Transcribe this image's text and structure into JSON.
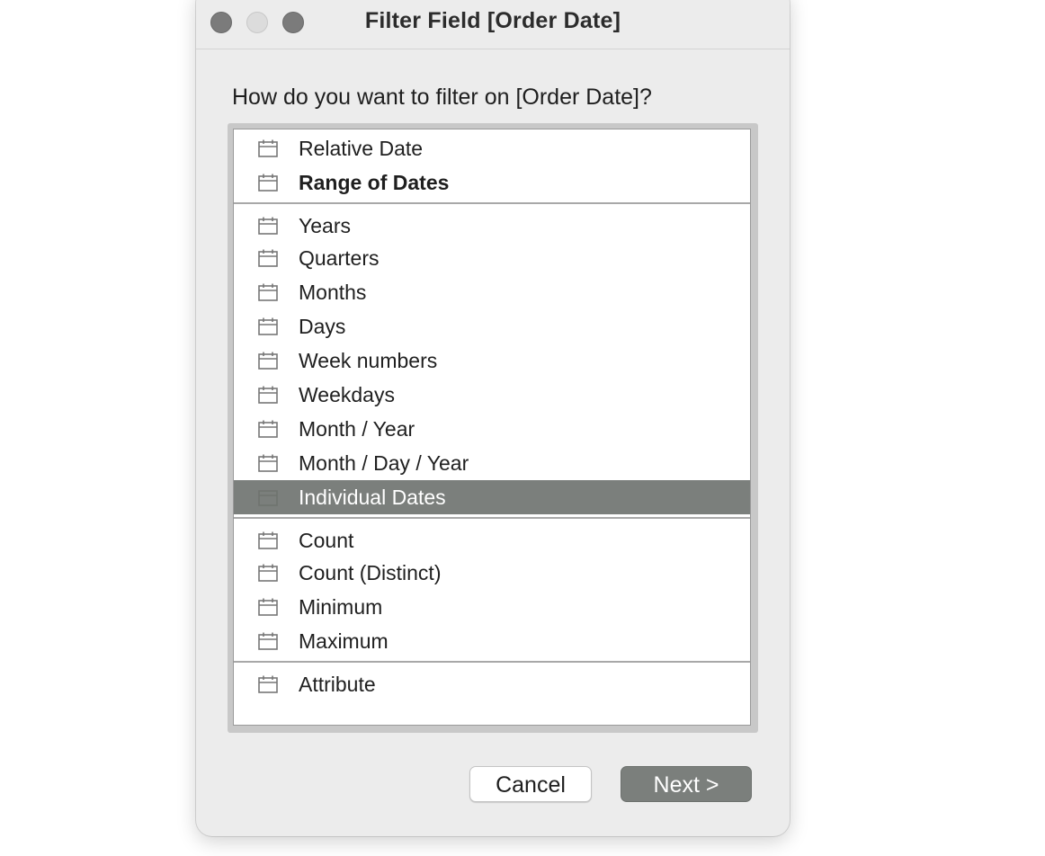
{
  "window": {
    "title": "Filter Field [Order Date]"
  },
  "dialog": {
    "prompt": "How do you want to filter on [Order Date]?"
  },
  "filter_options": {
    "group_date_range": [
      {
        "label": "Relative Date",
        "icon": "calendar-icon",
        "bold": false
      },
      {
        "label": "Range of Dates",
        "icon": "calendar-icon",
        "bold": true
      }
    ],
    "group_date_parts": [
      {
        "label": "Years",
        "icon": "calendar-icon"
      },
      {
        "label": "Quarters",
        "icon": "calendar-icon"
      },
      {
        "label": "Months",
        "icon": "calendar-icon"
      },
      {
        "label": "Days",
        "icon": "calendar-icon"
      },
      {
        "label": "Week numbers",
        "icon": "calendar-icon"
      },
      {
        "label": "Weekdays",
        "icon": "calendar-icon"
      },
      {
        "label": "Month / Year",
        "icon": "calendar-icon"
      },
      {
        "label": "Month / Day / Year",
        "icon": "calendar-icon"
      },
      {
        "label": "Individual Dates",
        "icon": "calendar-icon",
        "selected": true
      }
    ],
    "group_measures": [
      {
        "label": "Count",
        "icon": "calendar-icon"
      },
      {
        "label": "Count (Distinct)",
        "icon": "calendar-icon"
      },
      {
        "label": "Minimum",
        "icon": "calendar-icon"
      },
      {
        "label": "Maximum",
        "icon": "calendar-icon"
      }
    ],
    "group_attribute": [
      {
        "label": "Attribute",
        "icon": "calendar-icon"
      }
    ]
  },
  "buttons": {
    "cancel": "Cancel",
    "next": "Next >"
  },
  "colors": {
    "window_bg": "#ececec",
    "selection_bg": "#7b7f7c",
    "primary_button_bg": "#7b7f7c"
  }
}
